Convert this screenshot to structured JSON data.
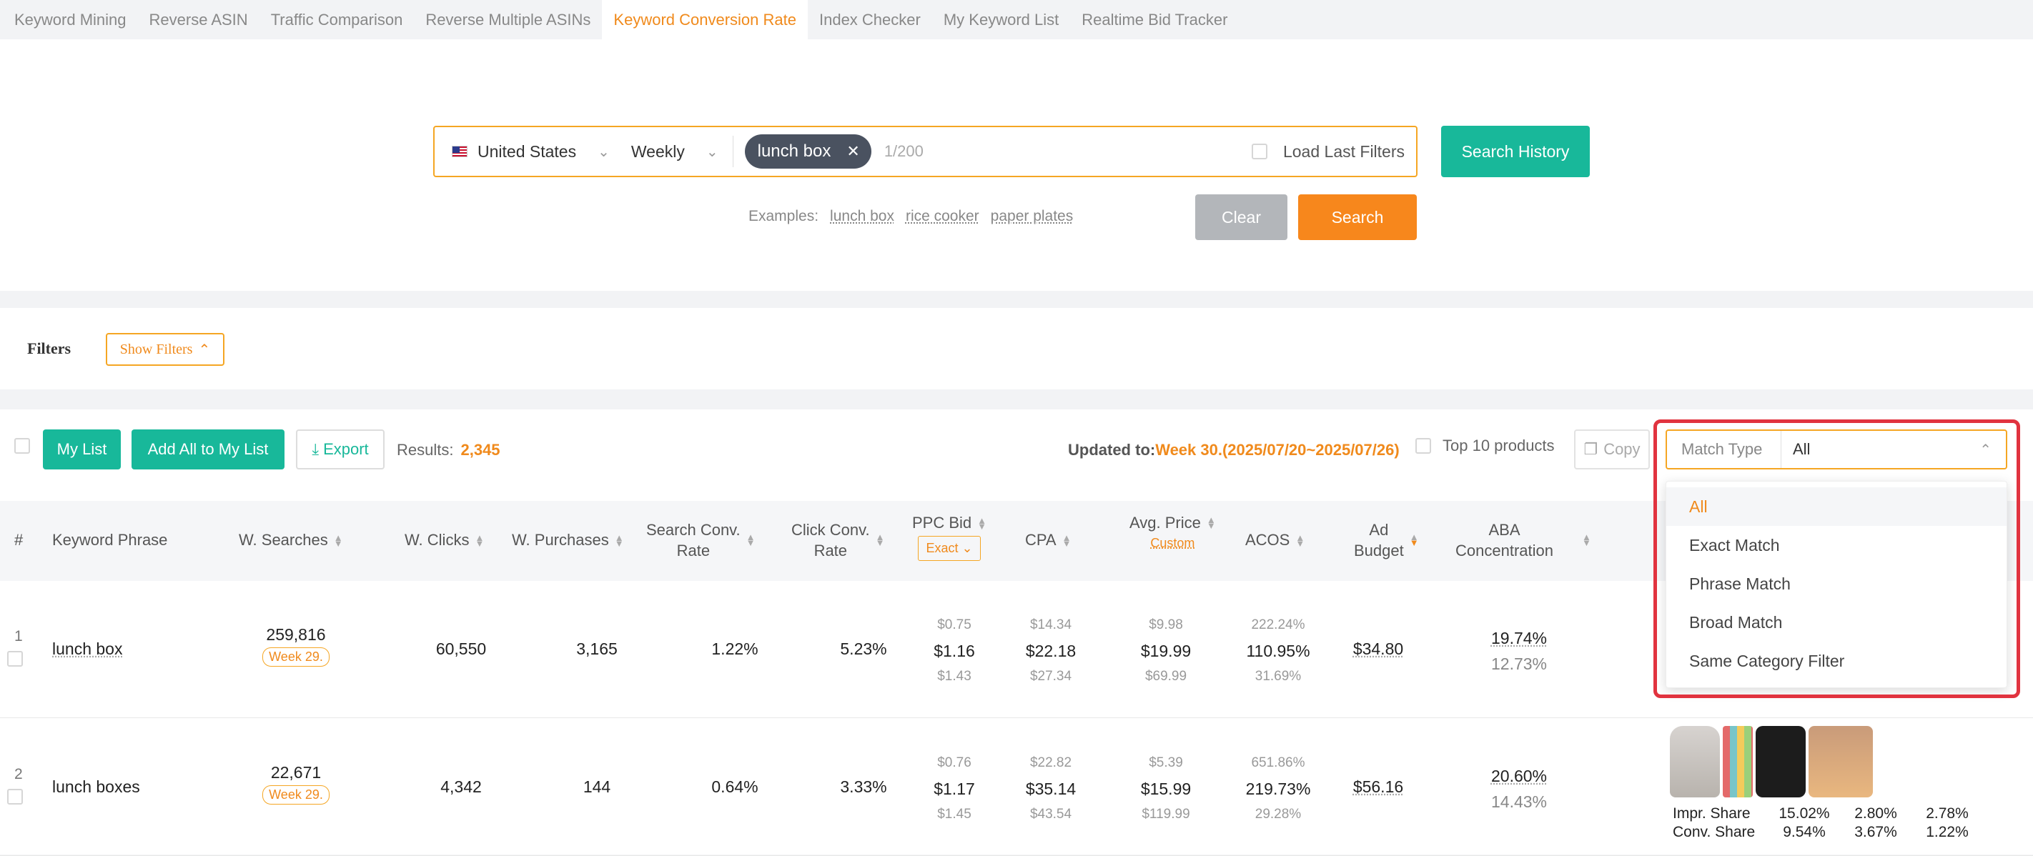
{
  "tabs": [
    {
      "label": "Keyword Mining",
      "active": false
    },
    {
      "label": "Reverse ASIN",
      "active": false
    },
    {
      "label": "Traffic Comparison",
      "active": false
    },
    {
      "label": "Reverse Multiple ASINs",
      "active": false
    },
    {
      "label": "Keyword Conversion Rate",
      "active": true
    },
    {
      "label": "Index Checker",
      "active": false
    },
    {
      "label": "My Keyword List",
      "active": false
    },
    {
      "label": "Realtime Bid Tracker",
      "active": false
    }
  ],
  "search": {
    "country": "United States",
    "period": "Weekly",
    "chip": "lunch box",
    "counter": "1/200",
    "load_last": "Load Last Filters",
    "history_button": "Search History",
    "examples_label": "Examples:",
    "examples": [
      "lunch box",
      "rice cooker",
      "paper plates"
    ],
    "clear_button": "Clear",
    "search_button": "Search"
  },
  "filters": {
    "title": "Filters",
    "show_button": "Show Filters"
  },
  "toolbar": {
    "my_list": "My List",
    "add_all": "Add All to My List",
    "export": "Export",
    "results_label": "Results:",
    "results_count": "2,345",
    "updated_label": "Updated to:",
    "updated_value": "Week 30.(2025/07/20~2025/07/26)",
    "top10": "Top 10 products",
    "copy": "Copy",
    "match_type_label": "Match Type",
    "match_type_value": "All"
  },
  "match_type_options": [
    "All",
    "Exact Match",
    "Phrase Match",
    "Broad Match",
    "Same Category Filter"
  ],
  "table": {
    "headers": {
      "idx": "#",
      "keyword": "Keyword Phrase",
      "searches": "W. Searches",
      "clicks": "W. Clicks",
      "purchases": "W. Purchases",
      "search_conv_1": "Search Conv.",
      "search_conv_2": "Rate",
      "click_conv_1": "Click Conv.",
      "click_conv_2": "Rate",
      "ppc": "PPC Bid",
      "ppc_sub": "Exact",
      "cpa": "CPA",
      "avg_price": "Avg. Price",
      "avg_price_sub": "Custom",
      "acos": "ACOS",
      "ad_budget_1": "Ad",
      "ad_budget_2": "Budget",
      "aba_1": "ABA",
      "aba_2": "Concentration"
    },
    "rows": [
      {
        "idx": "1",
        "keyword": "lunch box",
        "searches": "259,816",
        "week": "Week 29.",
        "clicks": "60,550",
        "purchases": "3,165",
        "search_conv": "1.22%",
        "click_conv": "5.23%",
        "ppc_low": "$0.75",
        "ppc": "$1.16",
        "ppc_high": "$1.43",
        "cpa_low": "$14.34",
        "cpa": "$22.18",
        "cpa_high": "$27.34",
        "price_low": "$9.98",
        "price": "$19.99",
        "price_high": "$69.99",
        "acos_low": "222.24%",
        "acos": "110.95%",
        "acos_high": "31.69%",
        "budget": "$34.80",
        "aba": "19.74%",
        "aba_sub": "12.73%"
      },
      {
        "idx": "2",
        "keyword": "lunch boxes",
        "searches": "22,671",
        "week": "Week 29.",
        "clicks": "4,342",
        "purchases": "144",
        "search_conv": "0.64%",
        "click_conv": "3.33%",
        "ppc_low": "$0.76",
        "ppc": "$1.17",
        "ppc_high": "$1.45",
        "cpa_low": "$22.82",
        "cpa": "$35.14",
        "cpa_high": "$43.54",
        "price_low": "$5.39",
        "price": "$15.99",
        "price_high": "$119.99",
        "acos_low": "651.86%",
        "acos": "219.73%",
        "acos_high": "29.28%",
        "budget": "$56.16",
        "aba": "20.60%",
        "aba_sub": "14.43%",
        "impr_label": "Impr. Share",
        "conv_label": "Conv. Share",
        "impr": [
          "15.02%",
          "2.80%",
          "2.78%"
        ],
        "conv": [
          "9.54%",
          "3.67%",
          "1.22%"
        ]
      }
    ]
  },
  "colors": {
    "accent": "#f08a1c",
    "teal": "#18b89a",
    "highlight": "#e1333f"
  }
}
